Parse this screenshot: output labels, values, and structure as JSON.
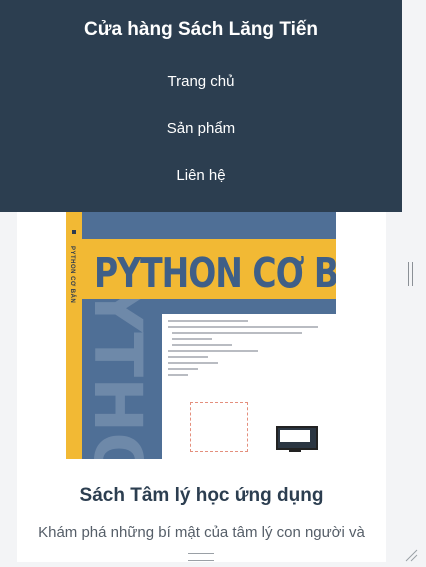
{
  "header": {
    "brand": "Cửa hàng Sách Lăng Tiến",
    "nav": [
      {
        "label": "Trang chủ"
      },
      {
        "label": "Sản phẩm"
      },
      {
        "label": "Liên hệ"
      }
    ]
  },
  "product": {
    "cover_title": "PYTHON CƠ BẢN",
    "cover_spine": "PYTHON CƠ BẢN",
    "cover_watermark": "PYTHON",
    "title": "Sách Tâm lý học ứng dụng",
    "description": "Khám phá những bí mật của tâm lý con người và"
  },
  "colors": {
    "header_bg": "#2c3e50",
    "cover_blue": "#4f6f96",
    "cover_yellow": "#f2b934"
  }
}
